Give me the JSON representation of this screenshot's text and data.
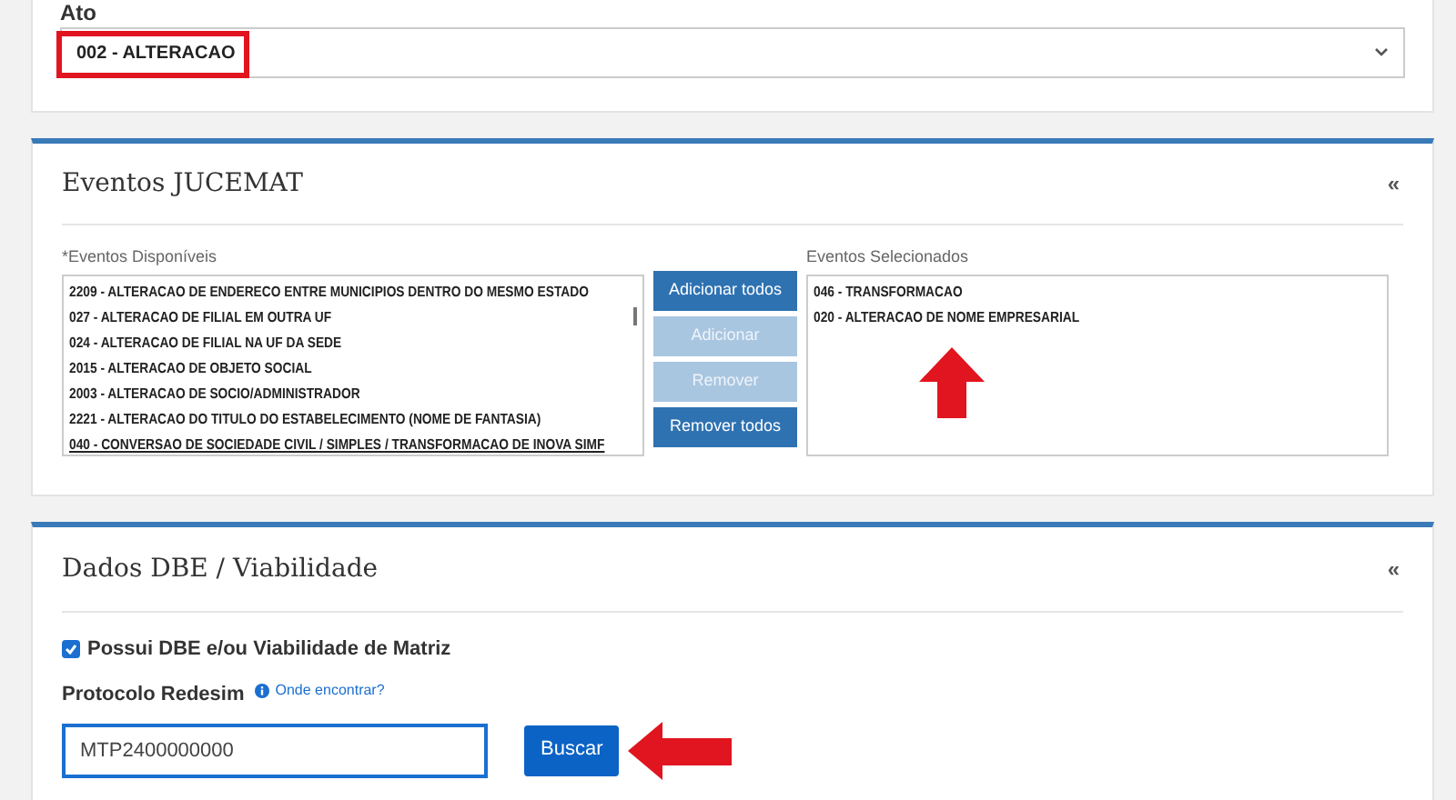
{
  "ato": {
    "label": "Ato",
    "value": "002 - ALTERACAO"
  },
  "eventos": {
    "title": "Eventos JUCEMAT",
    "collapse": "«",
    "available_label": "*Eventos Disponíveis",
    "selected_label": "Eventos Selecionados",
    "available": [
      {
        "text": "2209 - ALTERACAO DE ENDERECO ENTRE MUNICIPIOS DENTRO DO MESMO ESTADO",
        "highlighted": false
      },
      {
        "text": "027 - ALTERACAO DE FILIAL EM OUTRA UF",
        "highlighted": false
      },
      {
        "text": "024 - ALTERACAO DE FILIAL NA UF DA SEDE",
        "highlighted": false
      },
      {
        "text": "2015 - ALTERACAO DE OBJETO SOCIAL",
        "highlighted": false
      },
      {
        "text": "2003 - ALTERACAO DE SOCIO/ADMINISTRADOR",
        "highlighted": false
      },
      {
        "text": "2221 - ALTERACAO DO TITULO DO ESTABELECIMENTO (NOME DE FANTASIA)",
        "highlighted": false
      },
      {
        "text": "040 - CONVERSAO DE SOCIEDADE CIVIL / SIMPLES / TRANSFORMACAO DE INOVA SIMF",
        "highlighted": true
      }
    ],
    "buttons": [
      {
        "label": "Adicionar todos",
        "disabled": false
      },
      {
        "label": "Adicionar",
        "disabled": true
      },
      {
        "label": "Remover",
        "disabled": true
      },
      {
        "label": "Remover todos",
        "disabled": false
      }
    ],
    "selected": [
      "046 - TRANSFORMACAO",
      "020 - ALTERACAO DE NOME EMPRESARIAL"
    ]
  },
  "dbe": {
    "title": "Dados DBE / Viabilidade",
    "collapse": "«",
    "checkbox": {
      "label": "Possui DBE e/ou Viabilidade de Matriz",
      "checked": true
    },
    "protocolo_label": "Protocolo Redesim",
    "help_link": "Onde encontrar?",
    "protocolo_value": "MTP2400000000",
    "search_button": "Buscar"
  },
  "annotations": [
    {
      "kind": "box"
    },
    {
      "kind": "arrow_up"
    },
    {
      "kind": "arrow_left"
    }
  ]
}
